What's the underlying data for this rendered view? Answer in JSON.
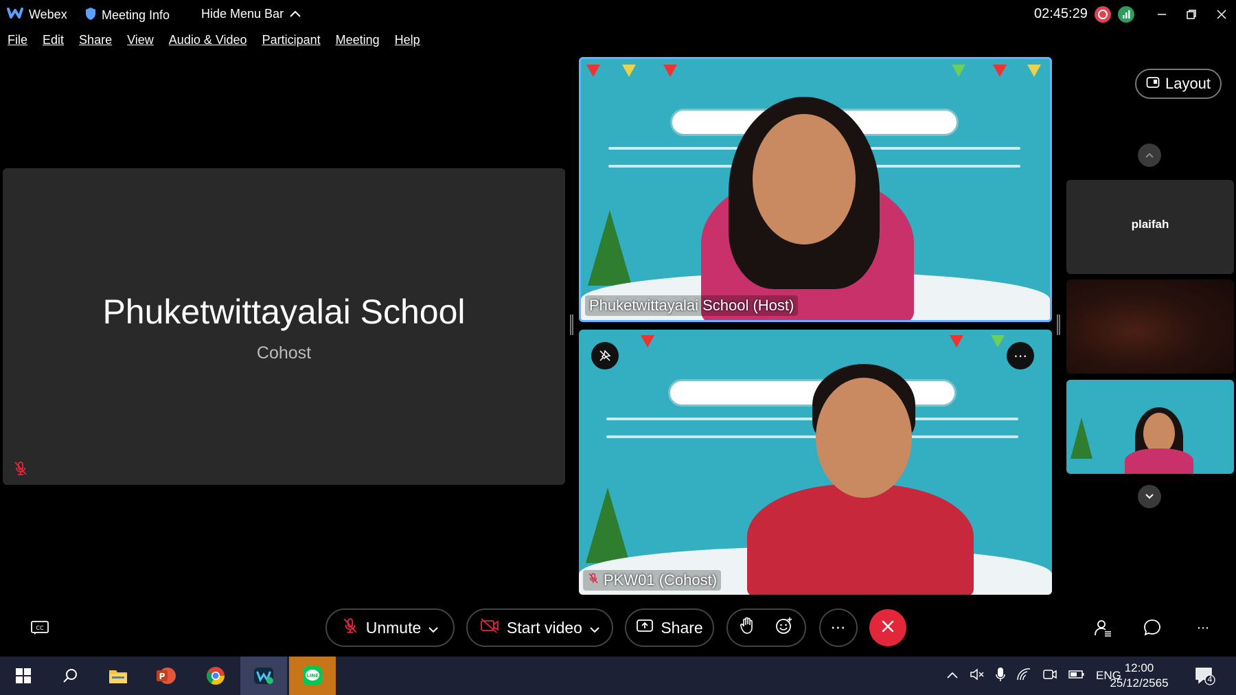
{
  "titlebar": {
    "app_name": "Webex",
    "meeting_info": "Meeting Info",
    "hide_menu": "Hide Menu Bar",
    "clock": "02:45:29"
  },
  "menu": [
    "File",
    "Edit",
    "Share",
    "View",
    "Audio & Video",
    "Participant",
    "Meeting",
    "Help"
  ],
  "main_tile": {
    "name": "Phuketwittayalai School",
    "role": "Cohost"
  },
  "videos": [
    {
      "label": "Phuketwittayalai School (Host)"
    },
    {
      "label": "PKW01 (Cohost)"
    }
  ],
  "right_panel": {
    "layout_label": "Layout",
    "thumb_name": "plaifah"
  },
  "controls": {
    "unmute": "Unmute",
    "start_video": "Start video",
    "share": "Share"
  },
  "taskbar": {
    "lang": "ENG",
    "time": "12:00",
    "date": "25/12/2565",
    "notifications": "4"
  },
  "colors": {
    "accent": "#64b2ff",
    "leave": "#e3273b",
    "slide_bg": "#34aec1"
  }
}
